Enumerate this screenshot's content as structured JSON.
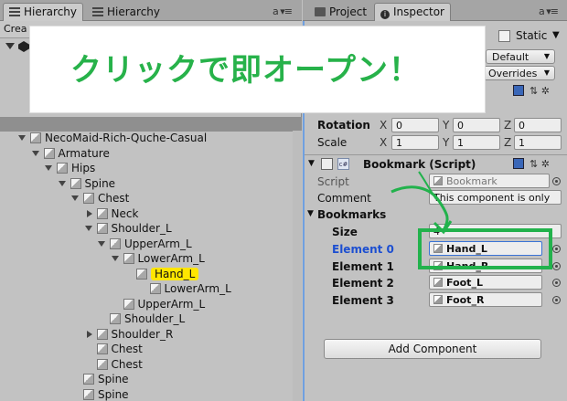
{
  "left_panel": {
    "tabs": [
      {
        "label": "Hierarchy",
        "icon": "list-icon",
        "active": true
      },
      {
        "label": "Hierarchy",
        "icon": "list-icon",
        "active": false
      }
    ],
    "tab_menu": "a ▾≡",
    "create_label": "Crea",
    "tree": [
      {
        "label": "NecoMaid-Rich-Quche-Casual",
        "depth": 0,
        "arrow": "down"
      },
      {
        "label": "Armature",
        "depth": 1,
        "arrow": "down"
      },
      {
        "label": "Hips",
        "depth": 2,
        "arrow": "down"
      },
      {
        "label": "Spine",
        "depth": 3,
        "arrow": "down"
      },
      {
        "label": "Chest",
        "depth": 4,
        "arrow": "down"
      },
      {
        "label": "Neck",
        "depth": 5,
        "arrow": "right"
      },
      {
        "label": "Shoulder_L",
        "depth": 5,
        "arrow": "down"
      },
      {
        "label": "UpperArm_L",
        "depth": 6,
        "arrow": "down"
      },
      {
        "label": "LowerArm_L",
        "depth": 7,
        "arrow": "down"
      },
      {
        "label": "Hand_L",
        "depth": 8,
        "arrow": "none",
        "selected": true
      },
      {
        "label": "LowerArm_L",
        "depth": 9,
        "arrow": "none"
      },
      {
        "label": "UpperArm_L",
        "depth": 7,
        "arrow": "none"
      },
      {
        "label": "Shoulder_L",
        "depth": 6,
        "arrow": "none"
      },
      {
        "label": "Shoulder_R",
        "depth": 5,
        "arrow": "right"
      },
      {
        "label": "Chest",
        "depth": 5,
        "arrow": "none"
      },
      {
        "label": "Chest",
        "depth": 5,
        "arrow": "none"
      },
      {
        "label": "Spine",
        "depth": 4,
        "arrow": "none"
      },
      {
        "label": "Spine",
        "depth": 4,
        "arrow": "none"
      }
    ]
  },
  "right_panel": {
    "tabs": [
      {
        "label": "Project",
        "icon": "folder-icon",
        "active": false
      },
      {
        "label": "Inspector",
        "icon": "info-icon",
        "active": true
      }
    ],
    "tab_menu": "a ▾≡",
    "static_label": "Static",
    "default_dropdown": "Default",
    "overrides_dropdown": "Overrides",
    "transform": {
      "rotation_label": "Rotation",
      "rotation": {
        "x": "0",
        "y": "0",
        "z": "0"
      },
      "scale_label": "Scale",
      "scale": {
        "x": "1",
        "y": "1",
        "z": "1"
      },
      "axis_x": "X",
      "axis_y": "Y",
      "axis_z": "Z"
    },
    "bookmark_component": {
      "title": "Bookmark (Script)",
      "script_label": "Script",
      "script_value": "Bookmark",
      "comment_label": "Comment",
      "comment_value": "This component is only",
      "bookmarks_label": "Bookmarks",
      "size_label": "Size",
      "size_value": "4",
      "elements": [
        {
          "label": "Element 0",
          "value": "Hand_L",
          "focused": true
        },
        {
          "label": "Element 1",
          "value": "Hand_R",
          "focused": false
        },
        {
          "label": "Element 2",
          "value": "Foot_L",
          "focused": false
        },
        {
          "label": "Element 3",
          "value": "Foot_R",
          "focused": false
        }
      ]
    },
    "add_component_label": "Add Component"
  },
  "banner": {
    "text": "クリックで即オープン！",
    "color": "#27b24a"
  },
  "colors": {
    "selection_highlight": "#ffe600",
    "annotation_green": "#22b24c",
    "element_label_blue": "#1d4fd1"
  }
}
